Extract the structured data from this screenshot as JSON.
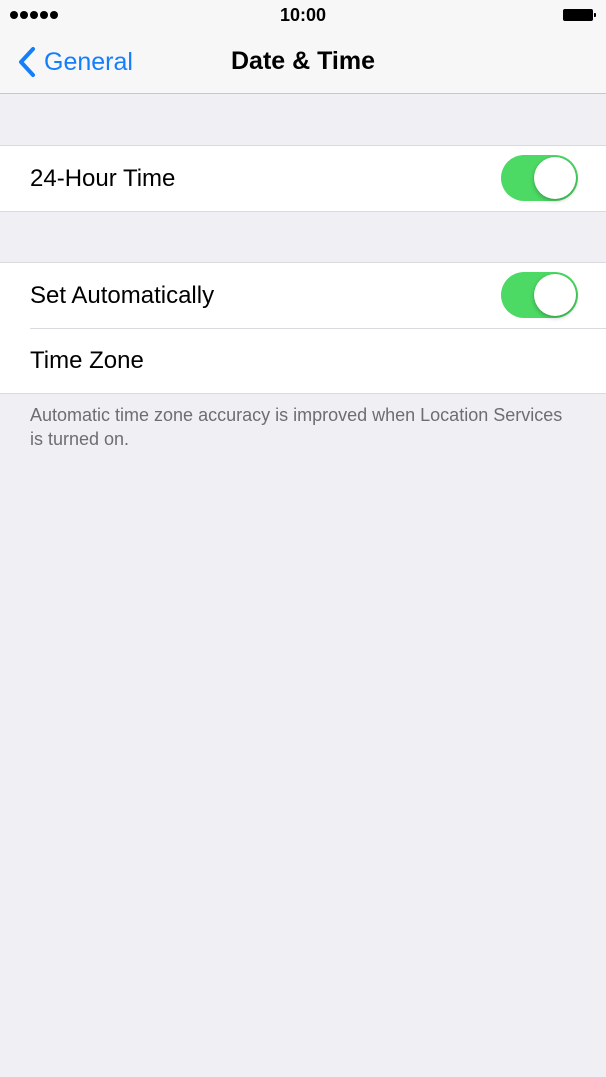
{
  "status_bar": {
    "signal_icon": "signal-dots-icon",
    "time": "10:00",
    "battery_icon": "battery-icon"
  },
  "nav": {
    "back_label": "General",
    "back_icon": "chevron-left-icon",
    "title": "Date & Time",
    "accent_color": "#157efb"
  },
  "sections": [
    {
      "rows": [
        {
          "label": "24-Hour Time",
          "toggle": true,
          "value": "on"
        }
      ]
    },
    {
      "rows": [
        {
          "label": "Set Automatically",
          "toggle": true,
          "value": "on"
        },
        {
          "label": "Time Zone"
        }
      ],
      "footer": "Automatic time zone accuracy is improved when Location Services is turned on."
    }
  ],
  "colors": {
    "toggle_on": "#4cd964",
    "background": "#efeff4",
    "footer_text": "#6d6d72"
  }
}
